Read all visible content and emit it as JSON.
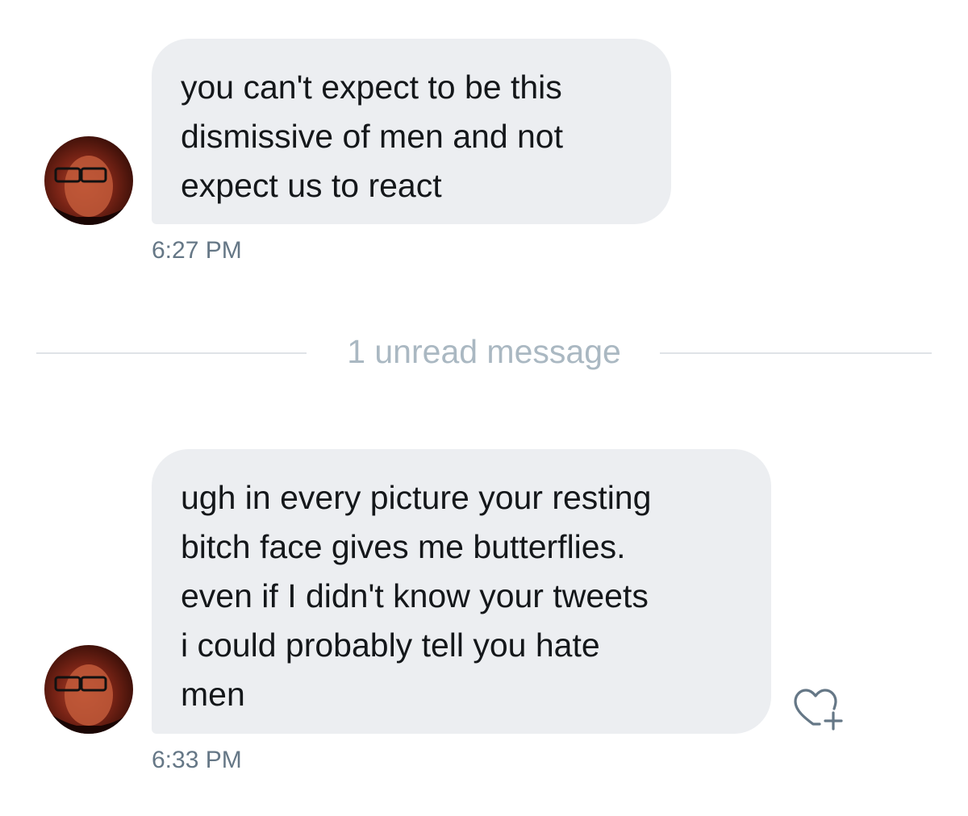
{
  "conversation": {
    "messages": [
      {
        "text": "you can't expect to be this\ndismissive of men and not\nexpect us to react",
        "time": "6:27 PM"
      },
      {
        "text": "ugh in every picture your resting\nbitch face gives me butterflies.\neven if I didn't know your tweets\ni could probably tell you hate\nmen",
        "time": "6:33 PM"
      }
    ],
    "unread_divider": "1 unread message",
    "react_icon": "heart-plus-icon",
    "avatar_icon": "user-avatar"
  }
}
